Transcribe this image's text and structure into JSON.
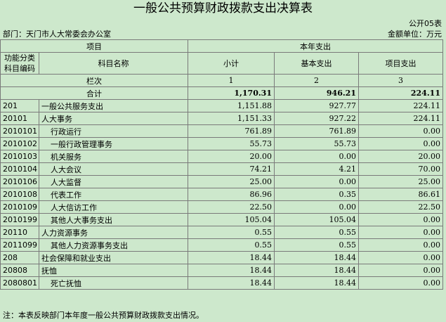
{
  "title": "一般公共预算财政拨款支出决算表",
  "form_code": "公开05表",
  "department": "部门：天门市人大常委会办公室",
  "unit": "金额单位：万元",
  "header": {
    "item": "项目",
    "current_year": "本年支出",
    "code_label": "功能分类科目编码",
    "name_label": "科目名称",
    "subtotal": "小计",
    "basic": "基本支出",
    "project": "项目支出",
    "row_index": "栏次",
    "col1": "1",
    "col2": "2",
    "col3": "3"
  },
  "total": {
    "label": "合计",
    "subtotal": "1,170.31",
    "basic": "946.21",
    "project": "224.11"
  },
  "rows": [
    {
      "code": "201",
      "name": "一般公共服务支出",
      "subtotal": "1,151.88",
      "basic": "927.77",
      "project": "224.11"
    },
    {
      "code": "20101",
      "name": "人大事务",
      "subtotal": "1,151.33",
      "basic": "927.22",
      "project": "224.11"
    },
    {
      "code": "2010101",
      "name": "行政运行",
      "subtotal": "761.89",
      "basic": "761.89",
      "project": "0.00"
    },
    {
      "code": "2010102",
      "name": "一般行政管理事务",
      "subtotal": "55.73",
      "basic": "55.73",
      "project": "0.00"
    },
    {
      "code": "2010103",
      "name": "机关服务",
      "subtotal": "20.00",
      "basic": "0.00",
      "project": "20.00"
    },
    {
      "code": "2010104",
      "name": "人大会议",
      "subtotal": "74.21",
      "basic": "4.21",
      "project": "70.00"
    },
    {
      "code": "2010106",
      "name": "人大监督",
      "subtotal": "25.00",
      "basic": "0.00",
      "project": "25.00"
    },
    {
      "code": "2010108",
      "name": "代表工作",
      "subtotal": "86.96",
      "basic": "0.35",
      "project": "86.61"
    },
    {
      "code": "2010109",
      "name": "人大信访工作",
      "subtotal": "22.50",
      "basic": "0.00",
      "project": "22.50"
    },
    {
      "code": "2010199",
      "name": "其他人大事务支出",
      "subtotal": "105.04",
      "basic": "105.04",
      "project": "0.00"
    },
    {
      "code": "20110",
      "name": "人力资源事务",
      "subtotal": "0.55",
      "basic": "0.55",
      "project": "0.00"
    },
    {
      "code": "2011099",
      "name": "其他人力资源事务支出",
      "subtotal": "0.55",
      "basic": "0.55",
      "project": "0.00"
    },
    {
      "code": "208",
      "name": "社会保障和就业支出",
      "subtotal": "18.44",
      "basic": "18.44",
      "project": "0.00"
    },
    {
      "code": "20808",
      "name": "抚恤",
      "subtotal": "18.44",
      "basic": "18.44",
      "project": "0.00"
    },
    {
      "code": "2080801",
      "name": "死亡抚恤",
      "subtotal": "18.44",
      "basic": "18.44",
      "project": "0.00"
    }
  ],
  "note": "注：本表反映部门本年度一般公共预算财政拨款支出情况。"
}
